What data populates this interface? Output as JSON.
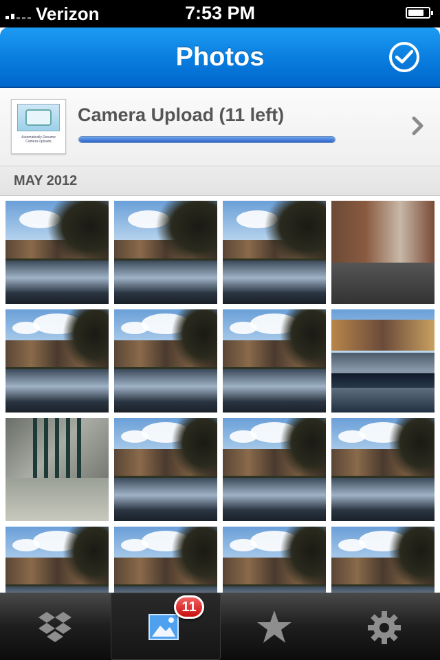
{
  "status_bar": {
    "carrier": "Verizon",
    "time": "7:53 PM",
    "signal_bars": 2,
    "battery_level": 0.8
  },
  "nav": {
    "title": "Photos",
    "select_icon": "checkmark-circle-icon"
  },
  "upload": {
    "label": "Camera Upload (11 left)",
    "progress": 1.0,
    "thumbnail_caption": "Automatically Resume Camera Uploads",
    "chevron_icon": "chevron-right-icon"
  },
  "section": {
    "title": "MAY 2012"
  },
  "photos": [
    {
      "scene": "canal-tree"
    },
    {
      "scene": "canal-tree"
    },
    {
      "scene": "canal-tree"
    },
    {
      "scene": "street-bikes"
    },
    {
      "scene": "canal-houses"
    },
    {
      "scene": "canal-houses"
    },
    {
      "scene": "canal-houses"
    },
    {
      "scene": "canal-railing"
    },
    {
      "scene": "grate-ledge"
    },
    {
      "scene": "canal-houses"
    },
    {
      "scene": "canal-houses"
    },
    {
      "scene": "canal-houses"
    },
    {
      "scene": "canal-houses"
    },
    {
      "scene": "canal-houses"
    },
    {
      "scene": "canal-houses"
    },
    {
      "scene": "canal-houses"
    }
  ],
  "tabs": [
    {
      "name": "dropbox",
      "icon": "dropbox-icon",
      "active": false
    },
    {
      "name": "photos",
      "icon": "photos-icon",
      "active": true,
      "badge": "11"
    },
    {
      "name": "favorites",
      "icon": "star-icon",
      "active": false
    },
    {
      "name": "settings",
      "icon": "gear-icon",
      "active": false
    }
  ],
  "colors": {
    "nav_blue": "#0a7fe0",
    "progress_blue": "#2d63c8",
    "badge_red": "#c80f0f"
  }
}
